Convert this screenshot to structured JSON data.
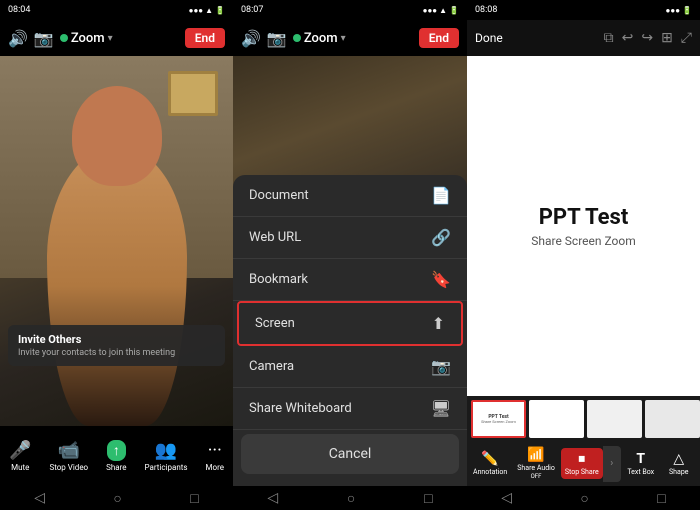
{
  "panel1": {
    "status_bar": {
      "time": "08:04",
      "carrier": "●●●●",
      "battery": "■■■■"
    },
    "top_bar": {
      "zoom_label": "Zoom",
      "end_label": "End"
    },
    "invite": {
      "title": "Invite Others",
      "subtitle": "Invite your contacts to join this meeting"
    },
    "bottom_items": [
      {
        "id": "mute",
        "label": "Mute",
        "icon": "🎤"
      },
      {
        "id": "stop-video",
        "label": "Stop Video",
        "icon": "📷"
      },
      {
        "id": "share",
        "label": "Share",
        "icon": "↑"
      },
      {
        "id": "participants",
        "label": "Participants",
        "icon": "👥"
      },
      {
        "id": "more",
        "label": "More",
        "icon": "•••"
      }
    ]
  },
  "panel2": {
    "status_bar": {
      "time": "08:07"
    },
    "top_bar": {
      "zoom_label": "Zoom",
      "end_label": "End"
    },
    "menu_items": [
      {
        "id": "document",
        "label": "Document",
        "icon": "📄",
        "highlighted": false
      },
      {
        "id": "web-url",
        "label": "Web URL",
        "icon": "🔗",
        "highlighted": false
      },
      {
        "id": "bookmark",
        "label": "Bookmark",
        "icon": "🔖",
        "highlighted": false
      },
      {
        "id": "screen",
        "label": "Screen",
        "icon": "⬆",
        "highlighted": true
      },
      {
        "id": "camera",
        "label": "Camera",
        "icon": "📷",
        "highlighted": false
      },
      {
        "id": "share-whiteboard",
        "label": "Share Whiteboard",
        "icon": "🖥",
        "highlighted": false
      }
    ],
    "cancel_label": "Cancel"
  },
  "panel3": {
    "status_bar": {
      "time": "08:08"
    },
    "top_bar": {
      "done_label": "Done"
    },
    "whiteboard": {
      "title": "PPT Test",
      "subtitle": "Share Screen Zoom"
    },
    "tools": [
      {
        "id": "annotation",
        "label": "Annotation",
        "icon": "✏️"
      },
      {
        "id": "share-audio",
        "label": "Share Audio\nOFF",
        "icon": "📶"
      },
      {
        "id": "stop-share",
        "label": "Stop Share",
        "icon": "⏹",
        "active": true
      },
      {
        "id": "text-box",
        "label": "Text Box",
        "icon": "T"
      },
      {
        "id": "shape",
        "label": "Shape",
        "icon": "△"
      }
    ]
  }
}
